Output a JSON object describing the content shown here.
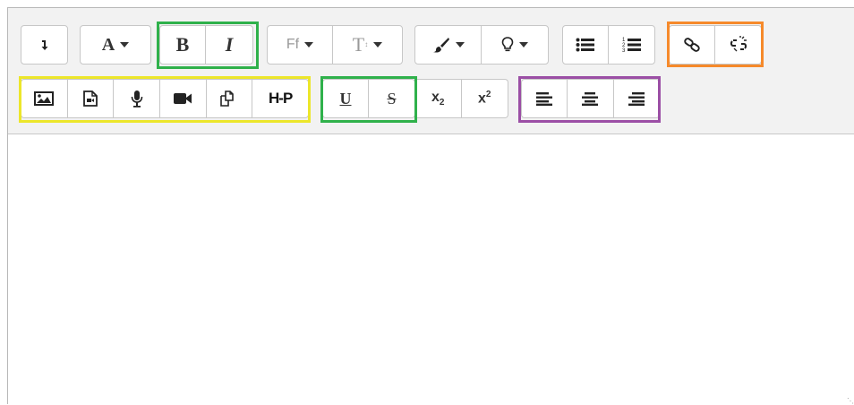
{
  "toolbar": {
    "row1": {
      "collapse_icon": "arrow-down-icon",
      "font_color_label": "A",
      "bold_label": "B",
      "italic_label": "I",
      "font_family_label": "Ff",
      "font_size_label": "T",
      "styles_icon": "brush-icon",
      "hint_icon": "lightbulb-icon",
      "unordered_list_icon": "bullet-list-icon",
      "ordered_list_icon": "numbered-list-icon",
      "ordered_list_digits": [
        "1",
        "2",
        "3"
      ],
      "link_icon": "link-icon",
      "unlink_icon": "unlink-icon"
    },
    "row2": {
      "image_icon": "image-icon",
      "media_icon": "file-media-icon",
      "record_audio_icon": "microphone-icon",
      "record_video_icon": "video-camera-icon",
      "manage_files_icon": "copy-files-icon",
      "h5p_label": "H-P",
      "underline_label": "U",
      "strike_label": "S",
      "subscript_label": "x",
      "subscript_digit": "2",
      "superscript_label": "x",
      "superscript_digit": "2",
      "align_left_icon": "align-left-icon",
      "align_center_icon": "align-center-icon",
      "align_right_icon": "align-right-icon"
    }
  },
  "colors": {
    "highlight_green": "#2fb14b",
    "highlight_yellow": "#ece62a",
    "highlight_orange": "#f68a2b",
    "highlight_purple": "#9b4fa5",
    "toolbar_bg": "#f2f2f2"
  },
  "content": {
    "text": ""
  }
}
